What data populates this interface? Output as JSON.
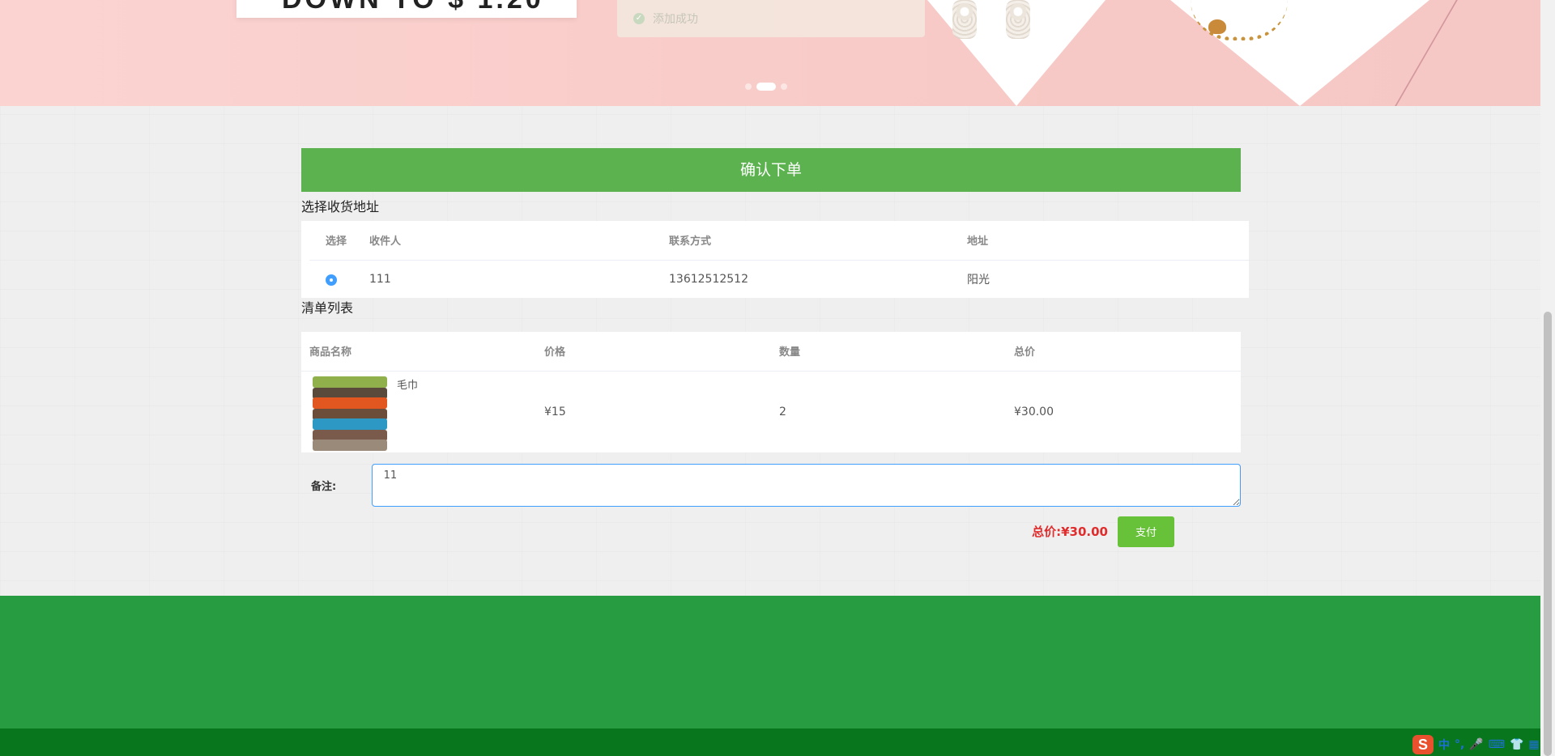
{
  "banner": {
    "promo_text": "DOWN TO $ 1.20",
    "toast_message": "添加成功",
    "carousel_dots": 3,
    "carousel_active_index": 1
  },
  "order": {
    "header_title": "确认下单",
    "address_section_title": "选择收货地址",
    "address_table": {
      "headers": [
        "选择",
        "收件人",
        "联系方式",
        "地址"
      ],
      "rows": [
        {
          "selected": true,
          "recipient": "111",
          "phone": "13612512512",
          "address": "阳光"
        }
      ]
    },
    "list_section_title": "清单列表",
    "goods_table": {
      "headers": [
        "商品名称",
        "价格",
        "数量",
        "总价"
      ],
      "rows": [
        {
          "name": "毛巾",
          "price": "¥15",
          "quantity": "2",
          "total": "¥30.00"
        }
      ]
    },
    "remark_label": "备注:",
    "remark_value": "11",
    "total_label": "总价:¥30.00",
    "pay_button": "支付"
  },
  "ime": {
    "logo": "S",
    "items": [
      "中",
      "°,",
      "🎤",
      "⌨",
      "👕",
      "▦"
    ]
  },
  "colors": {
    "header_green": "#5bb24e",
    "pay_green": "#67c23a",
    "footer_green": "#289c41",
    "footer_dark_green": "#08761c",
    "total_red": "#e02c2c",
    "focus_blue": "#409eff"
  }
}
